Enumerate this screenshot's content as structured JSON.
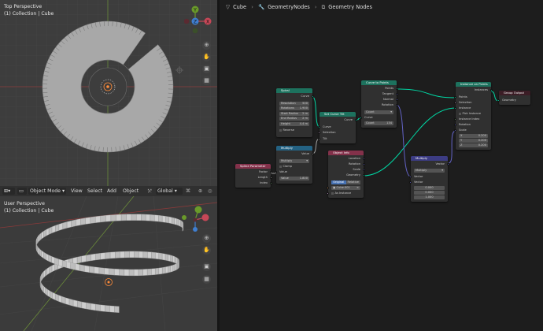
{
  "viewport_top": {
    "perspective_label": "Top Perspective",
    "collection_label": "(1) Collection | Cube",
    "gizmo": {
      "y": "Y",
      "x": "X",
      "z": "Z"
    },
    "tool_icons": [
      "zoom-icon",
      "hand-icon",
      "camera-icon",
      "grid-icon"
    ]
  },
  "header_bar": {
    "editor_icon": "editor-type-icon",
    "mode": "Object Mode",
    "menus": [
      "View",
      "Select",
      "Add",
      "Object"
    ],
    "orientation": "Global"
  },
  "viewport_user": {
    "perspective_label": "User Perspective",
    "collection_label": "(1) Collection | Cube"
  },
  "node_editor": {
    "breadcrumbs": [
      "Cube",
      "GeometryNodes",
      "Geometry Nodes"
    ],
    "colors": {
      "geometry": "#1d725e",
      "vector": "#3c3c83",
      "converter": "#246283",
      "input": "#83314a",
      "output": "#3c1d26"
    },
    "nodes": {
      "spiral": {
        "title": "Spiral",
        "out": "Curve",
        "fields": [
          {
            "label": "Resolution",
            "value": "500"
          },
          {
            "label": "Rotations",
            "value": "1.900"
          },
          {
            "label": "Start Radius",
            "value": "2 m"
          },
          {
            "label": "End Radius",
            "value": "2 m"
          },
          {
            "label": "Height",
            "value": "4.4 m"
          }
        ],
        "reverse": "Reverse"
      },
      "set_curve_tilt": {
        "title": "Set Curve Tilt",
        "out": "Curve",
        "in": [
          "Curve",
          "Selection",
          "Tilt"
        ]
      },
      "curve_to_points": {
        "title": "Curve to Points",
        "outs": [
          "Points",
          "Tangent",
          "Normal",
          "Rotation"
        ],
        "in_curve": "Curve",
        "mode": "Count",
        "count_label": "Count",
        "count_value": "134"
      },
      "multiply_top": {
        "title": "Multiply",
        "out": "Value",
        "op": "Multiply",
        "clamp": "Clamp",
        "in_value": "Value",
        "second_label": "Value",
        "second_value": "1.800"
      },
      "spline_parameter": {
        "title": "Spline Parameter",
        "outs": [
          "Factor",
          "Length",
          "Index"
        ]
      },
      "object_info": {
        "title": "Object Info",
        "outs": [
          "Location",
          "Rotation",
          "Scale",
          "Geometry"
        ],
        "toggle": [
          "Original",
          "Relative"
        ],
        "object": "Cube.001",
        "as_instance": "As Instance"
      },
      "vector_multiply": {
        "title": "Multiply",
        "out": "Vector",
        "op": "Multiply",
        "ins": [
          "Vector",
          "Vector"
        ],
        "values": [
          "0.000",
          "0.000",
          "1.000"
        ]
      },
      "instance_on_points": {
        "title": "Instance on Points",
        "out": "Instances",
        "ins": [
          "Points",
          "Selection",
          "Instance"
        ],
        "pick": "Pick Instance",
        "more_ins": [
          "Instance Index",
          "Rotation",
          "Scale"
        ],
        "scale_vals": [
          {
            "axis": "X",
            "value": "0.200"
          },
          {
            "axis": "Y",
            "value": "0.200"
          },
          {
            "axis": "Z",
            "value": "0.200"
          }
        ]
      },
      "group_output": {
        "title": "Group Output",
        "in": "Geometry"
      }
    }
  }
}
